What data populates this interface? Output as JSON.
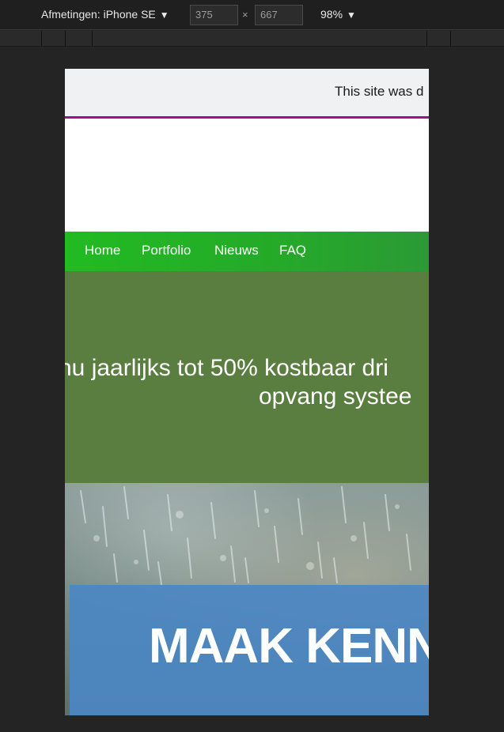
{
  "devtools": {
    "device_label": "Afmetingen: iPhone SE",
    "width_value": "375",
    "height_value": "667",
    "times_symbol": "×",
    "zoom_label": "98%",
    "caret": "▼"
  },
  "site": {
    "notice_text": "This site was d",
    "nav": {
      "home": "Home",
      "portfolio": "Portfolio",
      "nieuws": "Nieuws",
      "faq": "FAQ"
    },
    "banner": {
      "line1": "nu jaarlijks tot 50% kostbaar dri",
      "line2": "opvang systee"
    },
    "hero_title": "MAAK KENN"
  },
  "colors": {
    "accent_rule": "#a01288",
    "nav_green": "#22bb22",
    "banner_green": "#5a7d40",
    "hero_blue": "#4b87c3"
  }
}
